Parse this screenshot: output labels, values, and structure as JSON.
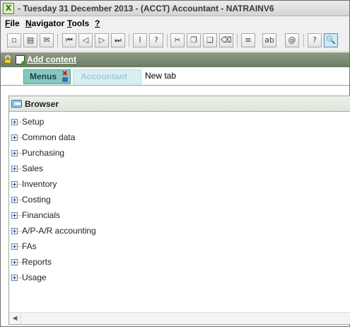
{
  "window": {
    "app_icon_glyph": "X",
    "title": "- Tuesday 31 December 2013 - (ACCT) Accountant - NATRAINV6"
  },
  "menubar": {
    "items": [
      {
        "label": "File",
        "mnemonic": "F"
      },
      {
        "label": "Navigator",
        "mnemonic": "N"
      },
      {
        "label": "Tools",
        "mnemonic": "T"
      },
      {
        "label": "?",
        "mnemonic": "?"
      }
    ]
  },
  "toolbar": {
    "buttons": [
      {
        "icon": "new-document-icon",
        "glyph": "▫"
      },
      {
        "icon": "print-icon",
        "glyph": "▤"
      },
      {
        "icon": "email-icon",
        "glyph": "✉"
      },
      {
        "icon": "first-record-icon",
        "glyph": "⏮"
      },
      {
        "icon": "previous-record-icon",
        "glyph": "◁"
      },
      {
        "icon": "next-record-icon",
        "glyph": "▷"
      },
      {
        "icon": "last-record-icon",
        "glyph": "⏭"
      },
      {
        "icon": "attachment-icon",
        "glyph": "⌇"
      },
      {
        "icon": "help-icon",
        "glyph": "?"
      },
      {
        "icon": "cut-icon",
        "glyph": "✂"
      },
      {
        "icon": "copy-icon",
        "glyph": "❐"
      },
      {
        "icon": "paste-icon",
        "glyph": "❏"
      },
      {
        "icon": "delete-line-icon",
        "glyph": "⌫"
      },
      {
        "icon": "list-view-icon",
        "glyph": "≡"
      },
      {
        "icon": "text-field-icon",
        "glyph": "ab"
      },
      {
        "icon": "link-icon",
        "glyph": "@"
      },
      {
        "icon": "about-icon",
        "glyph": "?"
      },
      {
        "icon": "zoom-search-icon",
        "glyph": "🔍"
      }
    ]
  },
  "contentbar": {
    "add_content_label": "Add content"
  },
  "tabs": [
    {
      "label": "Menus",
      "state": "active"
    },
    {
      "label": "Accountant",
      "state": "inactive"
    },
    {
      "label": "New tab",
      "state": "new"
    }
  ],
  "browser": {
    "title": "Browser",
    "items": [
      {
        "label": "Setup"
      },
      {
        "label": "Common data"
      },
      {
        "label": "Purchasing"
      },
      {
        "label": "Sales"
      },
      {
        "label": "Inventory"
      },
      {
        "label": "Costing"
      },
      {
        "label": "Financials"
      },
      {
        "label": "A/P-A/R accounting"
      },
      {
        "label": "FAs"
      },
      {
        "label": "Reports"
      },
      {
        "label": "Usage"
      }
    ],
    "scroll_left_glyph": "◀"
  }
}
